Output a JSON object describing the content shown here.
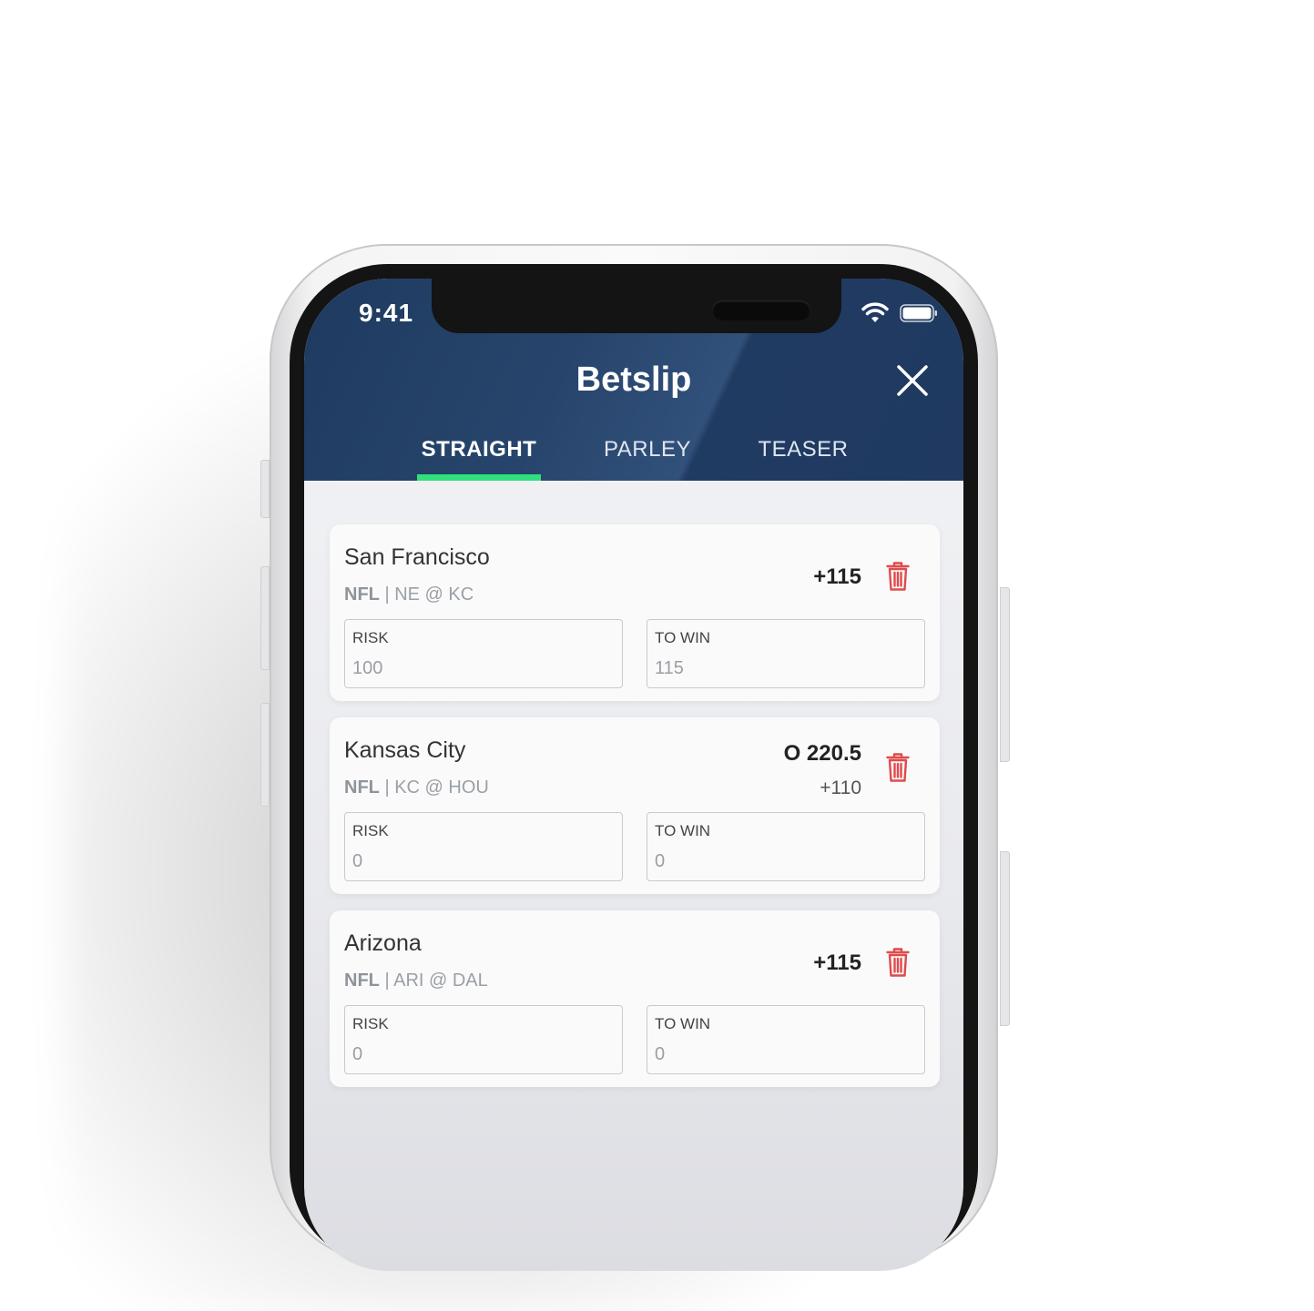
{
  "status_bar": {
    "time": "9:41"
  },
  "header": {
    "title": "Betslip",
    "tabs": [
      {
        "label": "STRAIGHT",
        "active": true
      },
      {
        "label": "PARLEY",
        "active": false
      },
      {
        "label": "TEASER",
        "active": false
      }
    ]
  },
  "bets": [
    {
      "team": "San Francisco",
      "league": "NFL",
      "matchup": "NE @ KC",
      "odds": "+115",
      "risk_label": "RISK",
      "risk": "100",
      "win_label": "TO WIN",
      "to_win": "115"
    },
    {
      "team": "Kansas City",
      "league": "NFL",
      "matchup": "KC @ HOU",
      "line": "O 220.5",
      "odds": "+110",
      "risk_label": "RISK",
      "risk": "0",
      "win_label": "TO WIN",
      "to_win": "0"
    },
    {
      "team": "Arizona",
      "league": "NFL",
      "matchup": "ARI @ DAL",
      "odds": "+115",
      "risk_label": "RISK",
      "risk": "0",
      "win_label": "TO WIN",
      "to_win": "0"
    }
  ],
  "colors": {
    "header": "#1f3a60",
    "active_tab_underline": "#2fe07c",
    "trash": "#e04b4b"
  },
  "icons": {
    "close": "close-icon",
    "delete": "trash-icon",
    "wifi": "wifi-icon",
    "battery": "battery-icon"
  }
}
